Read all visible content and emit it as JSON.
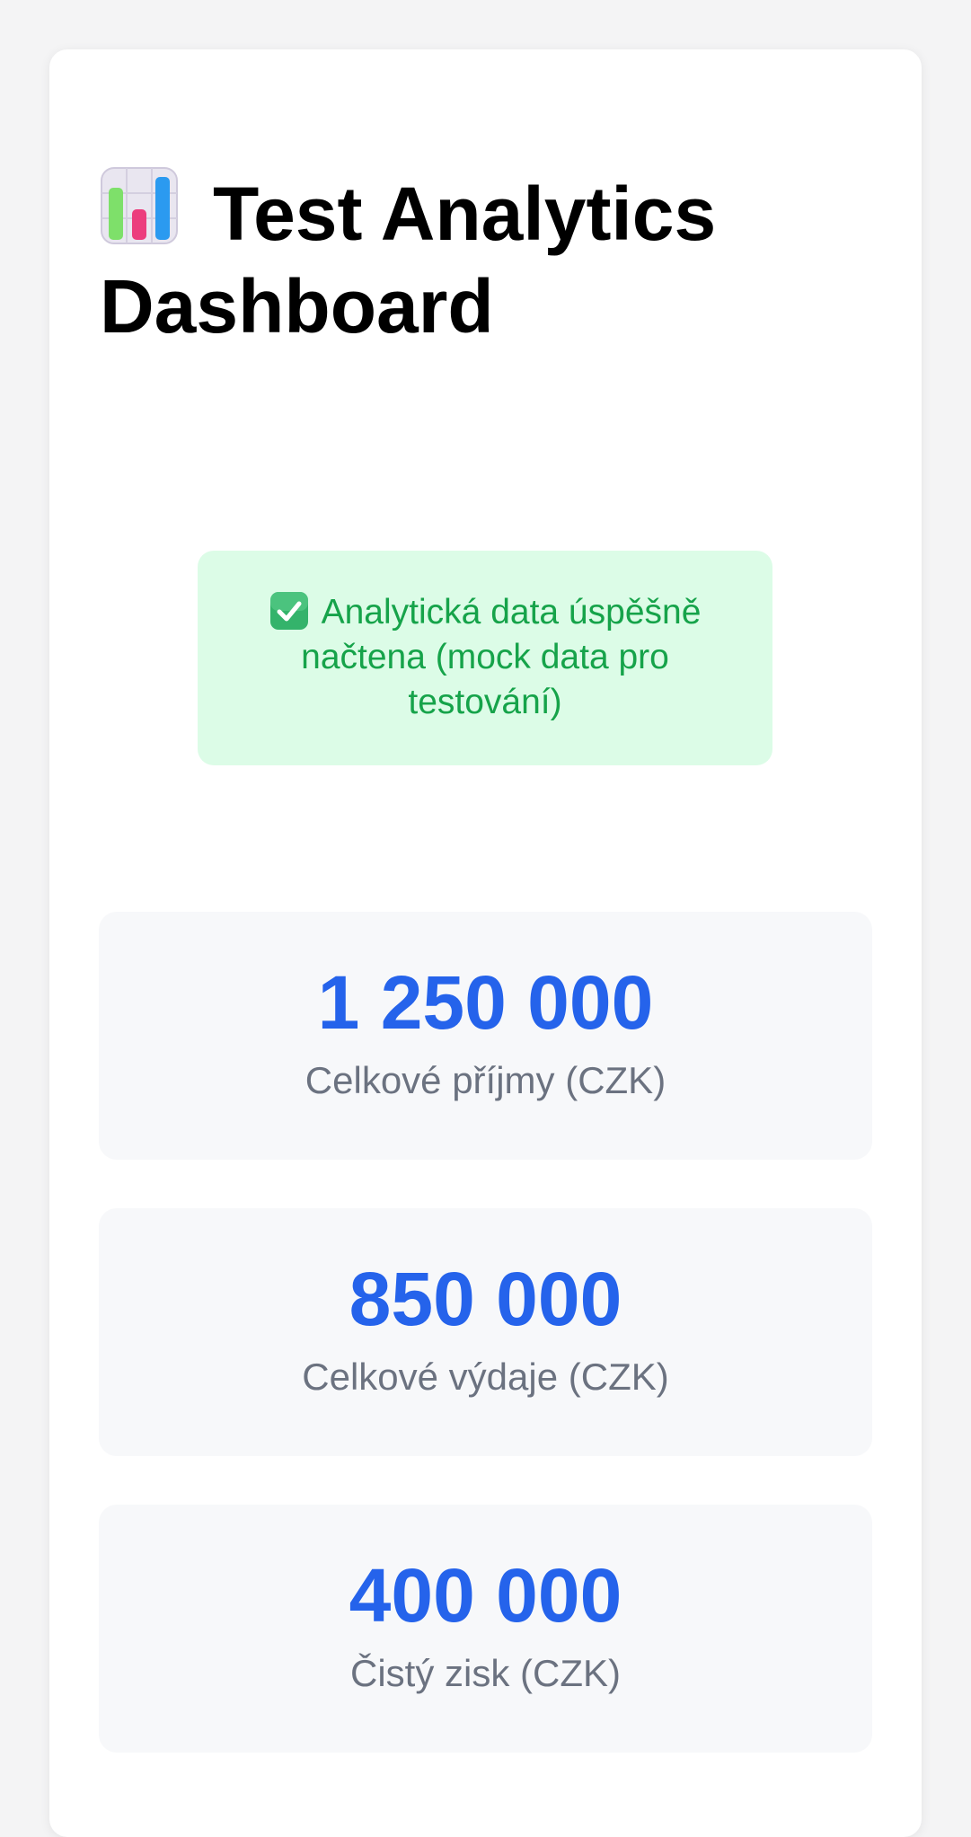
{
  "header": {
    "icon": "bar-chart-icon",
    "title": "Test Analytics Dashboard"
  },
  "status": {
    "icon": "check-mark-icon",
    "message": "Analytická data úspěšně načtena (mock data pro testování)"
  },
  "metrics": [
    {
      "value": "1 250 000",
      "label": "Celkové příjmy (CZK)"
    },
    {
      "value": "850 000",
      "label": "Celkové výdaje (CZK)"
    },
    {
      "value": "400 000",
      "label": "Čistý zisk (CZK)"
    }
  ],
  "colors": {
    "page_background": "#f4f4f5",
    "card_background": "#ffffff",
    "success_background": "#dcfce7",
    "success_text": "#16a34a",
    "metric_background": "#f7f8fa",
    "metric_value": "#2563eb",
    "metric_label": "#6b7280"
  }
}
